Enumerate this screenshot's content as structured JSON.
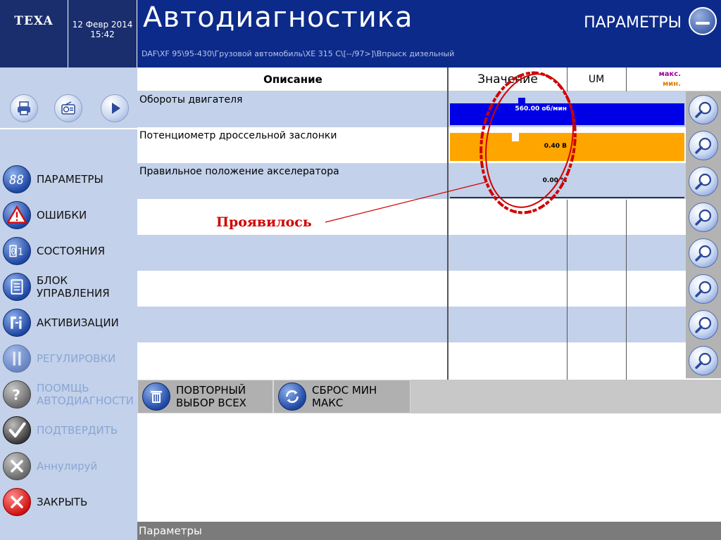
{
  "brand": {
    "logo_text": "TEXA"
  },
  "datetime": {
    "date": "12 Февр 2014",
    "time": "15:42"
  },
  "header": {
    "app_title": "Автодиагностика",
    "section_title": "ПАРАМЕТРЫ",
    "breadcrumb": "DAF\\XF 95\\95-430\\Грузовой автомобиль\\XE 315 C\\[--/97>]\\Впрыск дизельный"
  },
  "sidebar": {
    "toolbar": [
      {
        "name": "print-icon"
      },
      {
        "name": "radio-icon"
      },
      {
        "name": "play-icon"
      }
    ],
    "items": [
      {
        "label": "ПАРАМЕТРЫ",
        "icon": "parameters-icon",
        "enabled": true
      },
      {
        "label": "ОШИБКИ",
        "icon": "warning-icon",
        "enabled": true
      },
      {
        "label": "СОСТОЯНИЯ",
        "icon": "states-icon",
        "enabled": true
      },
      {
        "label_line1": "БЛОК",
        "label_line2": "УПРАВЛЕНИЯ",
        "icon": "control-unit-icon",
        "enabled": true
      },
      {
        "label": "АКТИВИЗАЦИИ",
        "icon": "activation-icon",
        "enabled": true
      },
      {
        "label": "РЕГУЛИРОВКИ",
        "icon": "adjustment-icon",
        "enabled": false
      },
      {
        "label_line1": "ПООМЩЬ",
        "label_line2": "АВТОДИАГНОСТИ",
        "icon": "help-icon",
        "enabled": false
      },
      {
        "label": "ПОДТВЕРДИТЬ",
        "icon": "checkmark-icon",
        "enabled": false
      },
      {
        "label": "Аннулируй",
        "icon": "cancel-icon",
        "enabled": false
      },
      {
        "label": "ЗАКРЫТЬ",
        "icon": "close-icon",
        "enabled": true
      }
    ]
  },
  "table": {
    "headers": {
      "description": "Описание",
      "value": "Значение",
      "um": "UM",
      "max": "макс.",
      "min": "мин."
    },
    "rows": [
      {
        "description": "Обороты двигателя",
        "value": "560.00 об/мин",
        "bar_color": "#0000e6",
        "fill": 1.0
      },
      {
        "description": "Потенциометр дроссельной заслонки",
        "value": "0.40 В",
        "bar_color": "#ffa500",
        "fill": 1.0
      },
      {
        "description": "Правильное положение акселератора",
        "value": "0.00 %",
        "bar_color": "#c3d1ea",
        "fill": 0
      },
      {
        "description": ""
      },
      {
        "description": ""
      },
      {
        "description": ""
      },
      {
        "description": ""
      },
      {
        "description": ""
      }
    ]
  },
  "bottom_buttons": {
    "reselect": {
      "line1": "ПОВТОРНЫЙ",
      "line2": "ВЫБОР ВСЕХ"
    },
    "reset": {
      "line1": "СБРОС МИН",
      "line2": "МАКС"
    }
  },
  "status_bar": {
    "text": "Параметры"
  },
  "annotation": {
    "text": "Проявилось"
  },
  "colors": {
    "header_blue": "#0c2a8a",
    "sidebar_bg": "#c3d1ea",
    "annotation_red": "#d00000"
  }
}
